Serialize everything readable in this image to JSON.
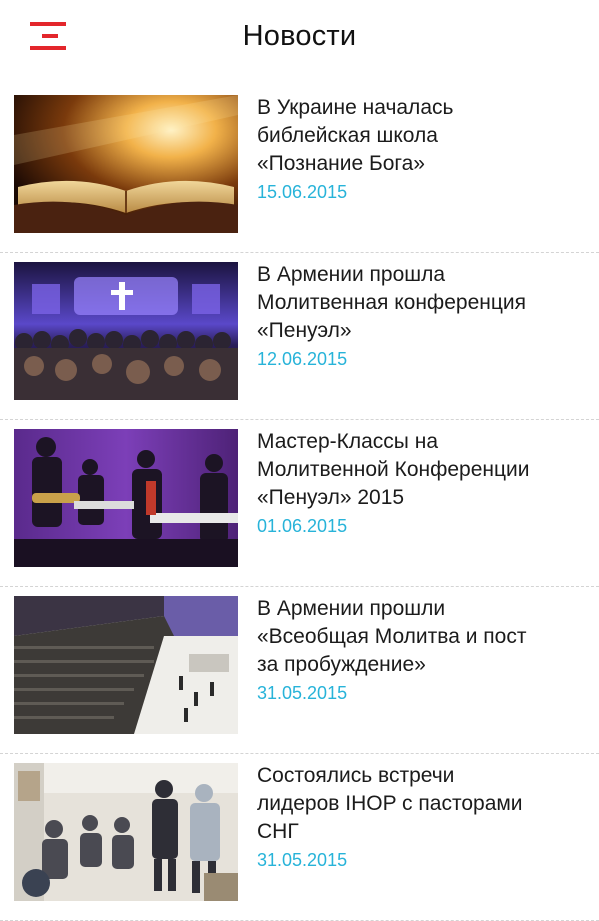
{
  "header": {
    "title": "Новости",
    "menu_icon": "menu-icon",
    "accent_color": "#e3262b"
  },
  "news": [
    {
      "headline": "В Украине началась\nбиблейская школа\n«Познание Бога»",
      "date": "15.06.2015",
      "image": "open-bible-photo"
    },
    {
      "headline": "В Армении прошла\nМолитвенная конференция\n«Пенуэл»",
      "date": "12.06.2015",
      "image": "conference-stage-photo"
    },
    {
      "headline": "Мастер-Классы на\nМолитвенной Конференции\n«Пенуэл» 2015",
      "date": "01.06.2015",
      "image": "worship-band-photo"
    },
    {
      "headline": "В Армении прошли\n«Всеобщая Молитва и пост\nза пробуждение»",
      "date": "31.05.2015",
      "image": "arena-audience-photo"
    },
    {
      "headline": "Состоялись встречи\nлидеров IHOP с пасторами\nСНГ",
      "date": "31.05.2015",
      "image": "leaders-meeting-photo"
    }
  ],
  "colors": {
    "date": "#27b3d9",
    "divider": "#d4d4d4"
  }
}
